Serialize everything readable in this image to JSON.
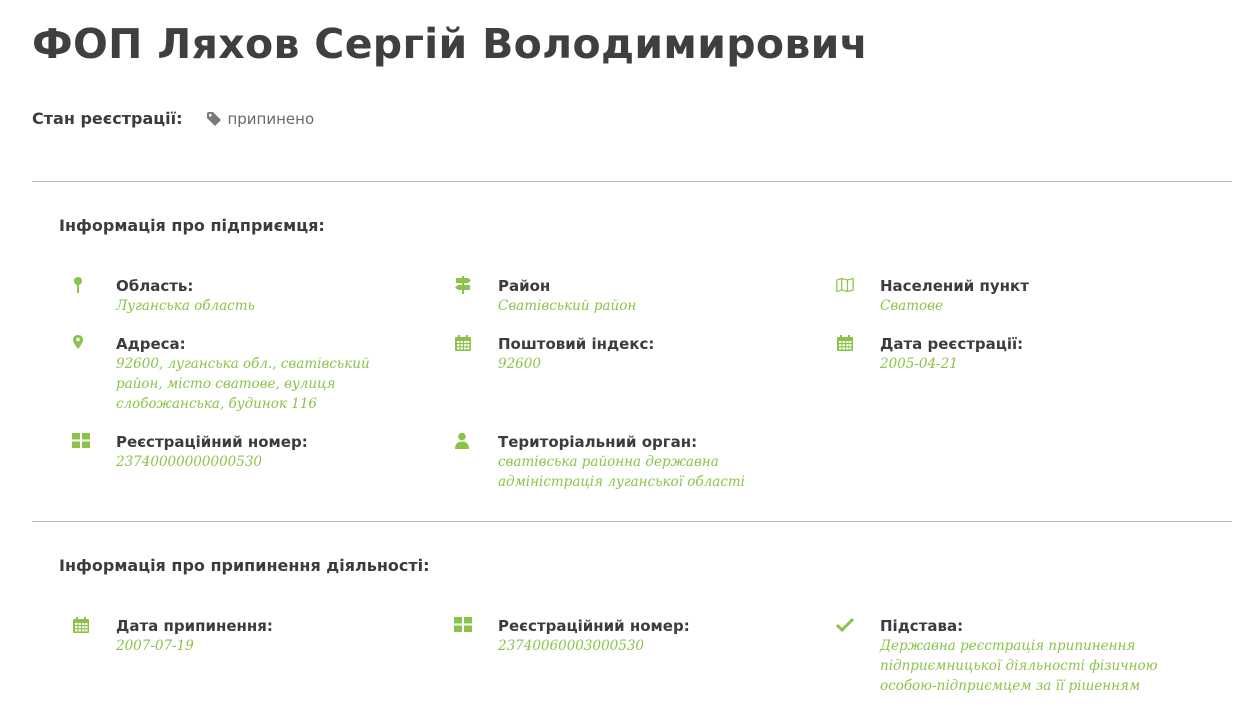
{
  "page": {
    "title": "ФОП Ляхов Сергій Володимирович",
    "status_label": "Стан реєстрації:",
    "status_value": "припинено"
  },
  "enterprise": {
    "section_title": "Інформація про підприємця:",
    "region": {
      "label": "Область:",
      "value": "Луганська область",
      "icon": "map-marker-pin-icon"
    },
    "district": {
      "label": "Район",
      "value": "Сватівський район",
      "icon": "signpost-icon"
    },
    "locality": {
      "label": "Населений пункт",
      "value": "Сватове",
      "icon": "map-icon"
    },
    "address": {
      "label": "Адреса:",
      "value": "92600, луганська обл., сватівський район, місто сватове, вулиця слобожанська, будинок 116",
      "icon": "location-pin-icon"
    },
    "postal_code": {
      "label": "Поштовий індекс:",
      "value": "92600",
      "icon": "calendar-icon"
    },
    "registration_date": {
      "label": "Дата реєстрації:",
      "value": "2005-04-21",
      "icon": "calendar-icon"
    },
    "registration_number": {
      "label": "Реєстраційний номер:",
      "value": "23740000000000530",
      "icon": "grid-icon"
    },
    "territorial_body": {
      "label": "Територіальний орган:",
      "value": "сватівська районна державна адміністрація луганської області",
      "icon": "user-icon"
    }
  },
  "termination": {
    "section_title": "Інформація про припинення діяльності:",
    "termination_date": {
      "label": "Дата припинення:",
      "value": "2007-07-19",
      "icon": "calendar-icon"
    },
    "registration_number": {
      "label": "Реєстраційний номер:",
      "value": "23740060003000530",
      "icon": "grid-icon"
    },
    "basis": {
      "label": "Підстава:",
      "value": "Державна реєстрація припинення підприємницької діяльності фізичною особою-підприємцем за її рішенням",
      "icon": "check-icon"
    }
  },
  "colors": {
    "accent": "#8bc34a",
    "text": "#3c3c3c",
    "divider": "#bdbdbd",
    "muted": "#6a6a6a"
  }
}
